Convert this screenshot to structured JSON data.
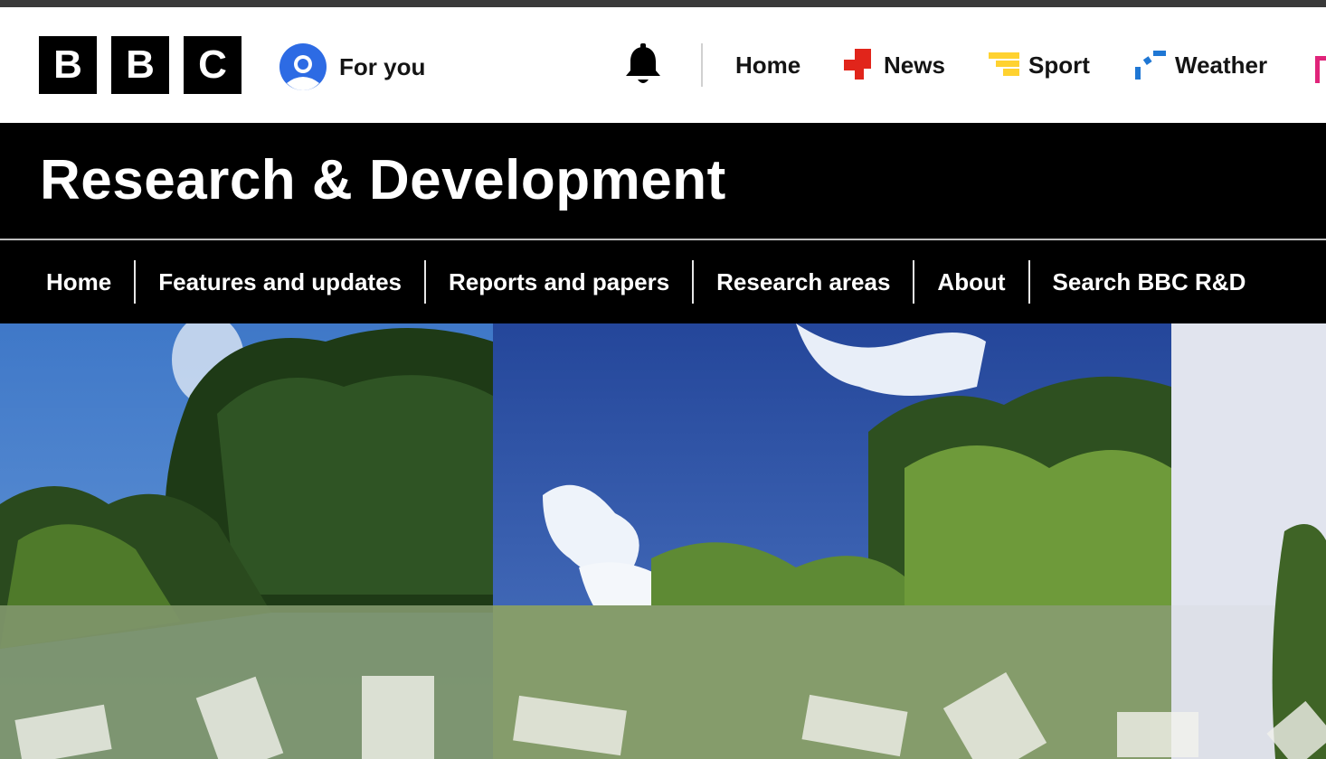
{
  "global_nav": {
    "logo_letters": [
      "B",
      "B",
      "C"
    ],
    "for_you_label": "For you",
    "items": [
      {
        "label": "Home",
        "icon": "none"
      },
      {
        "label": "News",
        "icon": "news-icon"
      },
      {
        "label": "Sport",
        "icon": "sport-icon"
      },
      {
        "label": "Weather",
        "icon": "weather-icon"
      }
    ],
    "colors": {
      "news": "#e1251b",
      "sport": "#ffd230",
      "weather": "#1f77d4"
    }
  },
  "banner": {
    "title": "Research & Development"
  },
  "rd_nav": {
    "items": [
      "Home",
      "Features and updates",
      "Reports and papers",
      "Research areas",
      "About",
      "Search BBC R&D"
    ]
  },
  "hero": {
    "description_icon": "trees-and-sky-image"
  }
}
